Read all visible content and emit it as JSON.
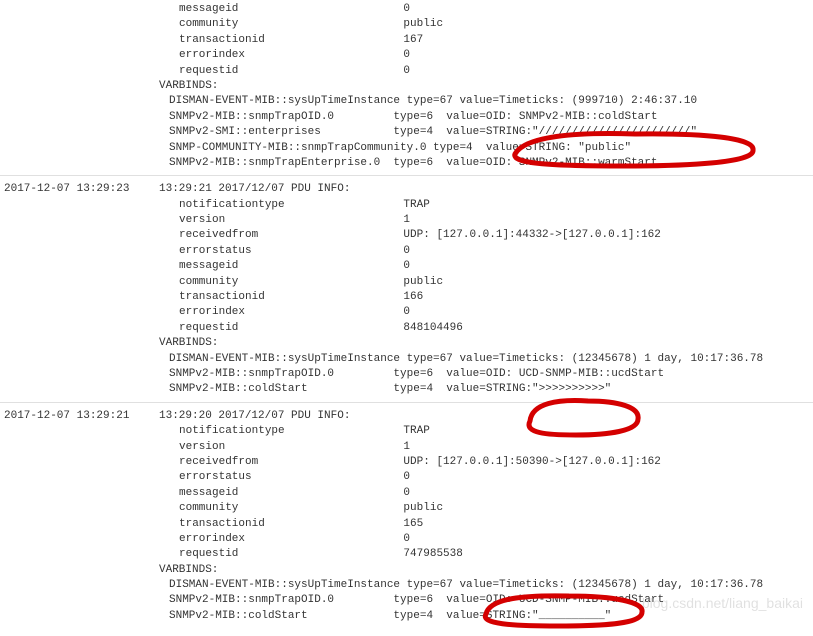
{
  "blocks": [
    {
      "timestamp": "",
      "pdu_line": "",
      "fields": [
        [
          "messageid",
          "0"
        ],
        [
          "community",
          "public"
        ],
        [
          "transactionid",
          "167"
        ],
        [
          "errorindex",
          "0"
        ],
        [
          "requestid",
          "0"
        ]
      ],
      "varbinds_label": "VARBINDS:",
      "varbinds": [
        "DISMAN-EVENT-MIB::sysUpTimeInstance type=67 value=Timeticks: (999710) 2:46:37.10",
        "SNMPv2-MIB::snmpTrapOID.0         type=6  value=OID: SNMPv2-MIB::coldStart",
        "SNMPv2-SMI::enterprises           type=4  value=STRING:\"///////////////////////\"",
        "SNMP-COMMUNITY-MIB::snmpTrapCommunity.0 type=4  value=STRING: \"public\"",
        "SNMPv2-MIB::snmpTrapEnterprise.0  type=6  value=OID: SNMPv2-MIB::warmStart"
      ]
    },
    {
      "timestamp": "2017-12-07 13:29:23",
      "pdu_line": "13:29:21 2017/12/07 PDU INFO:",
      "fields": [
        [
          "notificationtype",
          "TRAP"
        ],
        [
          "version",
          "1"
        ],
        [
          "receivedfrom",
          "UDP: [127.0.0.1]:44332->[127.0.0.1]:162"
        ],
        [
          "errorstatus",
          "0"
        ],
        [
          "messageid",
          "0"
        ],
        [
          "community",
          "public"
        ],
        [
          "transactionid",
          "166"
        ],
        [
          "errorindex",
          "0"
        ],
        [
          "requestid",
          "848104496"
        ]
      ],
      "varbinds_label": "VARBINDS:",
      "varbinds": [
        "DISMAN-EVENT-MIB::sysUpTimeInstance type=67 value=Timeticks: (12345678) 1 day, 10:17:36.78",
        "SNMPv2-MIB::snmpTrapOID.0         type=6  value=OID: UCD-SNMP-MIB::ucdStart",
        "SNMPv2-MIB::coldStart             type=4  value=STRING:\">>>>>>>>>>\""
      ]
    },
    {
      "timestamp": "2017-12-07 13:29:21",
      "pdu_line": "13:29:20 2017/12/07 PDU INFO:",
      "fields": [
        [
          "notificationtype",
          "TRAP"
        ],
        [
          "version",
          "1"
        ],
        [
          "receivedfrom",
          "UDP: [127.0.0.1]:50390->[127.0.0.1]:162"
        ],
        [
          "errorstatus",
          "0"
        ],
        [
          "messageid",
          "0"
        ],
        [
          "community",
          "public"
        ],
        [
          "transactionid",
          "165"
        ],
        [
          "errorindex",
          "0"
        ],
        [
          "requestid",
          "747985538"
        ]
      ],
      "varbinds_label": "VARBINDS:",
      "varbinds": [
        "DISMAN-EVENT-MIB::sysUpTimeInstance type=67 value=Timeticks: (12345678) 1 day, 10:17:36.78",
        "SNMPv2-MIB::snmpTrapOID.0         type=6  value=OID: UCD-SNMP-MIB::ucdStart",
        "SNMPv2-MIB::coldStart             type=4  value=STRING:\"__________\""
      ]
    }
  ],
  "watermark": "blog.csdn.net/liang_baikai"
}
